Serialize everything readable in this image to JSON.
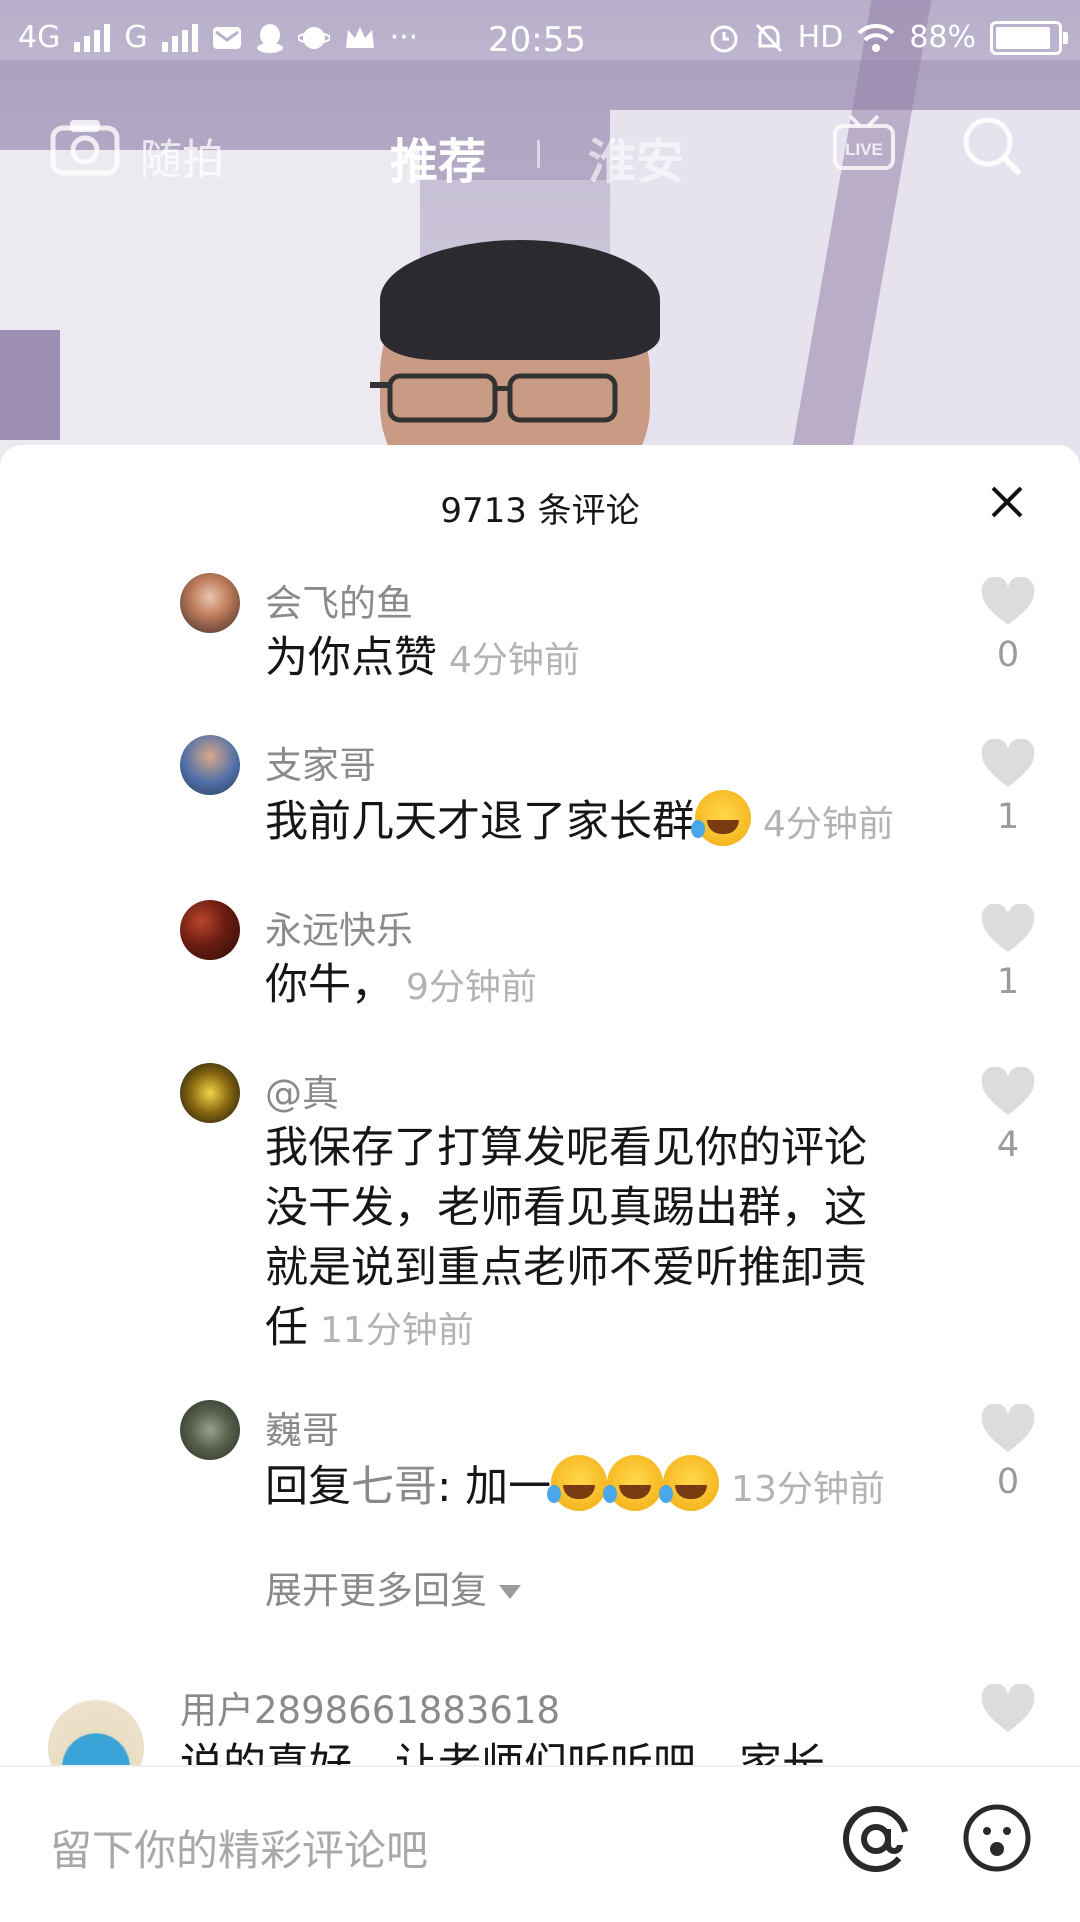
{
  "status_bar": {
    "network_left": "4G",
    "network_second": "G",
    "time": "20:55",
    "hd": "HD",
    "battery": "88%",
    "battery_level": 0.88
  },
  "top_nav": {
    "shoot_label": "随拍",
    "tab_recommend": "推荐",
    "tab_city": "淮安"
  },
  "comments_panel": {
    "title": "9713 条评论",
    "comments": [
      {
        "user": "会飞的鱼",
        "text": "为你点赞",
        "time": "4分钟前",
        "likes": "0"
      },
      {
        "user": "支家哥",
        "text": "我前几天才退了家长群",
        "time": "4分钟前",
        "likes": "1"
      },
      {
        "user": "永远快乐",
        "text": "你牛，",
        "time": "9分钟前",
        "likes": "1"
      },
      {
        "user": "@真",
        "text": "我保存了打算发呢看见你的评论没干发，老师看见真踢出群，这就是说到重点老师不爱听推卸责任",
        "time": "11分钟前",
        "likes": "4"
      },
      {
        "user": "巍哥",
        "reply_prefix": "回复",
        "reply_to": "七哥",
        "text": ": 加一",
        "time": "13分钟前",
        "likes": "0"
      }
    ],
    "expand_label": "展开更多回复",
    "next_comment": {
      "user": "用户2898661883618",
      "text": "说的真好，让老师们听听吧，家长"
    }
  },
  "input_bar": {
    "placeholder": "留下你的精彩评论吧"
  }
}
